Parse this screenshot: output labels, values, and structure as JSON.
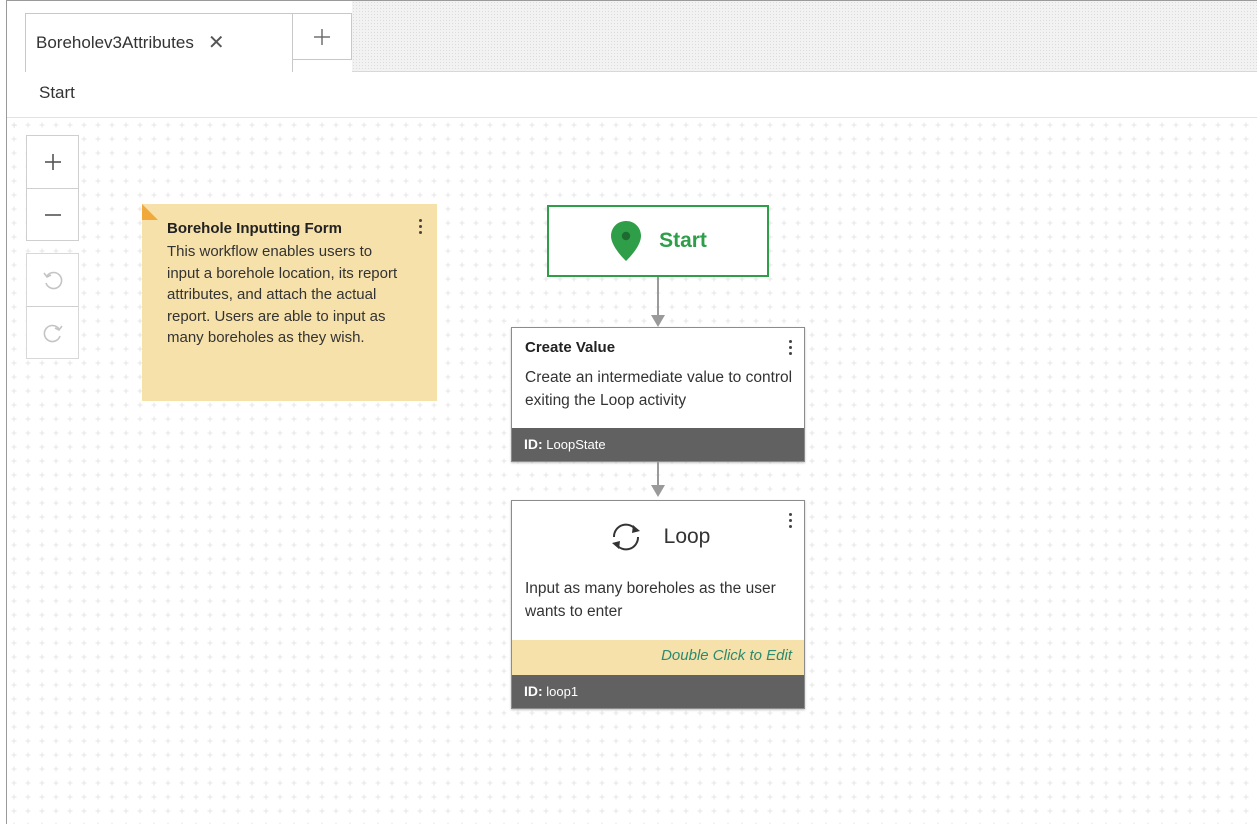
{
  "tab": {
    "label": "Boreholev3Attributes",
    "close_glyph": "✕"
  },
  "breadcrumb": {
    "label": "Start"
  },
  "note": {
    "title": "Borehole Inputting Form",
    "body": "This workflow enables users to input a borehole location, its report attributes, and attach the actual report. Users are able to input as many boreholes as they wish."
  },
  "start_node": {
    "label": "Start",
    "color": "#2e9e48"
  },
  "create_value": {
    "title": "Create Value",
    "description": "Create an intermediate value to control exiting the Loop activity",
    "id_label": "ID:",
    "id_value": "LoopState"
  },
  "loop": {
    "title": "Loop",
    "description": "Input as many boreholes as the user wants to enter",
    "edit_hint": "Double Click to Edit",
    "id_label": "ID:",
    "id_value": "loop1"
  },
  "icons": {
    "zoom_in": "plus-icon",
    "zoom_out": "minus-icon",
    "undo": "undo-icon",
    "redo": "redo-icon",
    "start": "map-pin-icon",
    "loop": "loop-arrows-icon"
  }
}
